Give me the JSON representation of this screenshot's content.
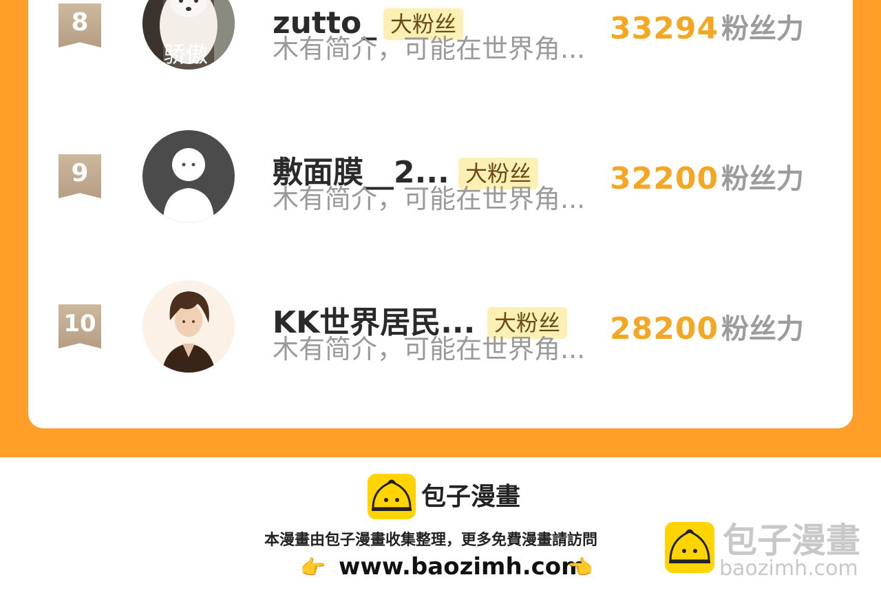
{
  "leaderboard": {
    "rows": [
      {
        "rank": "8",
        "name": "zutto_",
        "badge": "大粉丝",
        "bio": "木有简介，可能在世界角...",
        "score": "33294",
        "unit": "粉丝力",
        "avatar_caption": "骄傲"
      },
      {
        "rank": "9",
        "name": "敷面膜__2...",
        "badge": "大粉丝",
        "bio": "木有简介，可能在世界角...",
        "score": "32200",
        "unit": "粉丝力"
      },
      {
        "rank": "10",
        "name": "KK世界居民...",
        "badge": "大粉丝",
        "bio": "木有简介，可能在世界角...",
        "score": "28200",
        "unit": "粉丝力"
      }
    ]
  },
  "footer": {
    "brand": "包子漫畫",
    "tagline": "本漫畫由包子漫畫收集整理，更多免費漫畫請訪問",
    "url": "www.baozimh.com",
    "hand_left": "👉",
    "hand_right": "👈",
    "watermark_text": "包子漫畫",
    "watermark_url": "baozimh.com"
  },
  "colors": {
    "orange": "#ff9e28",
    "score": "#f5a623",
    "badge_bg": "#fdf0b4",
    "rank_badge": "#c4ad93",
    "logo_yellow": "#ffd400"
  }
}
